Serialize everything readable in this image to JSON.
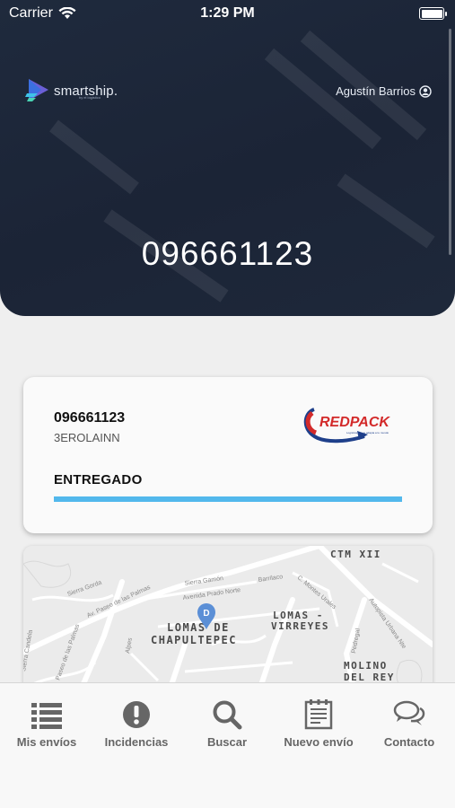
{
  "status_bar": {
    "carrier": "Carrier",
    "time": "1:29 PM"
  },
  "header": {
    "brand": "smartship.",
    "brand_sub": "by el logistico",
    "user_name": "Agustín Barrios",
    "tracking_number": "096661123"
  },
  "shipment_card": {
    "tracking_number": "096661123",
    "reference": "3EROLAINN",
    "carrier_name": "REDPACK",
    "carrier_tagline": "Logística que te adapta a tu mundo",
    "status": "ENTREGADO",
    "progress": 1.0
  },
  "map": {
    "labels": {
      "lomas_chapultepec_1": "LOMAS DE",
      "lomas_chapultepec_2": "CHAPULTEPEC",
      "lomas_virreyes_1": "LOMAS -",
      "lomas_virreyes_2": "VIRREYES",
      "molino_1": "MOLINO",
      "molino_2": "DEL REY",
      "ctm": "CTM XII"
    },
    "streets": {
      "paseo": "Av. Paseo de las Palmas",
      "sierra_gorda": "Sierra Gorda",
      "sierra_gamon": "Sierra Gamón",
      "prado_norte": "Avenida Prado Norte",
      "barrilaco": "Barrilaco",
      "monte_blanco": "C. Montes Urales",
      "urbana": "Autopista Urbana Nte",
      "paseo2": "Paseo de las Palmas",
      "sierra_candela": "Sierra Candela",
      "pedregal": "Pedregal",
      "alpes": "Alpes"
    },
    "pin_letter": "D",
    "colors": {
      "pin": "#5b8fd6"
    }
  },
  "tabbar": {
    "items": [
      {
        "label": "Mis envíos",
        "icon": "list-icon"
      },
      {
        "label": "Incidencias",
        "icon": "alert-circle-icon"
      },
      {
        "label": "Buscar",
        "icon": "search-icon"
      },
      {
        "label": "Nuevo envío",
        "icon": "document-icon"
      },
      {
        "label": "Contacto",
        "icon": "chat-bubbles-icon"
      }
    ]
  },
  "colors": {
    "header_bg": "#1d2638",
    "accent": "#52b8ec",
    "redpack_red": "#d32a2a",
    "redpack_blue": "#1e3f8a"
  }
}
